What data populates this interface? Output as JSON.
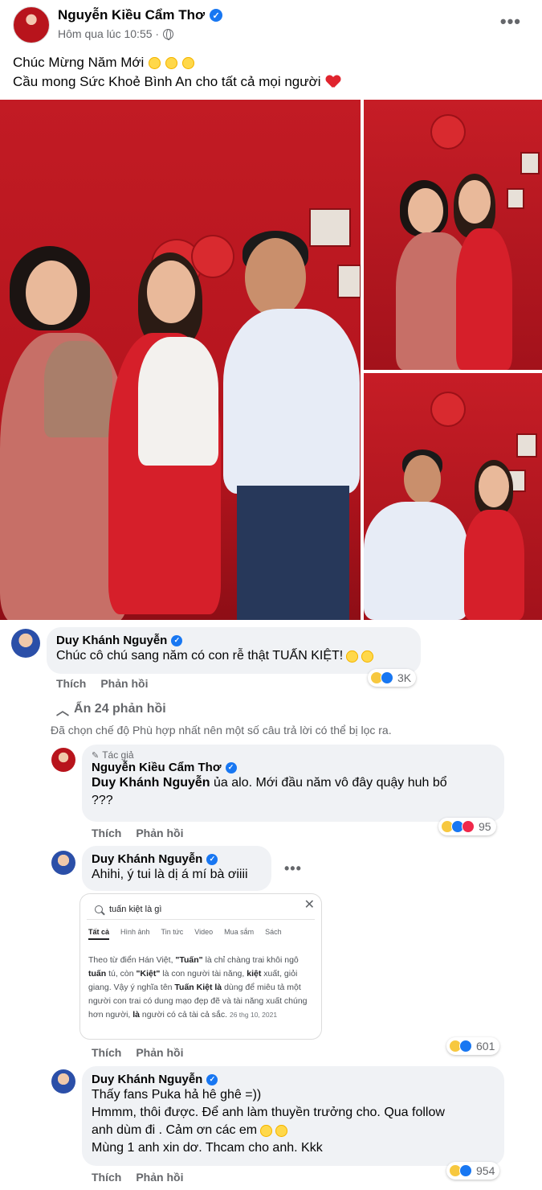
{
  "post": {
    "author": "Nguyễn Kiều Cẩm Thơ",
    "time": "Hôm qua lúc 10:55 ·",
    "line1": "Chúc Mừng Năm Mới",
    "line2": "Cầu mong Sức Khoẻ Bình An cho tất cả mọi người",
    "more": "•••"
  },
  "photos": [
    {
      "alt": "family-group-photo"
    },
    {
      "alt": "mother-daughter-photo"
    },
    {
      "alt": "father-daughter-photo"
    }
  ],
  "comments": {
    "c1": {
      "name": "Duy Khánh Nguyễn",
      "text": "Chúc cô chú sang năm có con rễ thật TUẤN KIỆT!",
      "like": "Thích",
      "reply": "Phản hồi",
      "count": "3K"
    },
    "hide_replies": "Ẩn 24 phản hồi",
    "filter_note": "Đã chọn chế độ Phù hợp nhất nên một số câu trả lời có thể bị lọc ra.",
    "r1": {
      "tag": "Tác giả",
      "name": "Nguyễn Kiều Cẩm Thơ",
      "mention": "Duy Khánh Nguyễn",
      "text": " ủa alo. Mới đầu năm vô đây quậy huh bổ",
      "text2": "???",
      "like": "Thích",
      "reply": "Phản hồi",
      "count": "95"
    },
    "r2": {
      "name": "Duy Khánh Nguyễn",
      "text": "Ahihi, ý tui là dị á mí bà ơiiii",
      "like": "Thích",
      "reply": "Phản hồi",
      "count": "601",
      "embed": {
        "query": "tuấn kiệt là gì",
        "tabs": [
          "Tất cả",
          "Hình ảnh",
          "Tin tức",
          "Video",
          "Mua sắm",
          "Sách"
        ],
        "p1": "Theo từ điển Hán Việt, ",
        "b1": "\"Tuấn\"",
        "p2": " là chỉ chàng trai khôi ngô ",
        "b2": "tuấn",
        "p3": " tú, còn ",
        "b3": "\"Kiệt\"",
        "p4": " là con người tài năng, ",
        "b4": "kiệt",
        "p5": " xuất, giỏi giang. Vậy ý nghĩa tên ",
        "b5": "Tuấn Kiệt là",
        "p6": " dùng để miêu tả một người con trai có dung mạo đẹp đẽ và tài năng xuất chúng hơn người, ",
        "b6": "là",
        "p7": " người có cả tài cả sắc.",
        "date": "26 thg 10, 2021"
      }
    },
    "r3": {
      "name": "Duy Khánh Nguyễn",
      "l1": "Thấy fans Puka hả hê ghê =))",
      "l2": "Hmmm, thôi được. Để anh làm thuyền trưởng cho. Qua follow",
      "l3": "anh dùm đi . Cảm ơn các em",
      "l4": "Mùng 1 anh xin dơ. Thcam cho anh. Kkk",
      "like": "Thích",
      "reply": "Phản hồi",
      "count": "954"
    }
  },
  "colors": {
    "accent": "#1877f2",
    "bubble": "#f0f2f5",
    "muted": "#65676b",
    "photo_bg": "#b8141c"
  }
}
